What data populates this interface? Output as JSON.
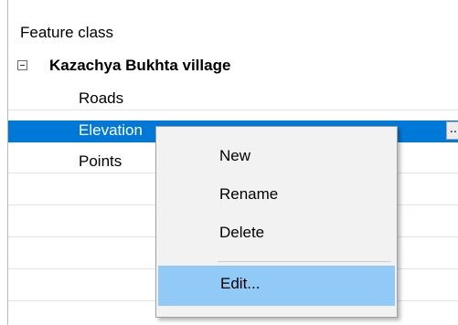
{
  "header": {
    "title": "Feature class"
  },
  "tree": {
    "group": {
      "label": "Kazachya Bukhta village",
      "expanded": true
    },
    "items": [
      {
        "label": "Roads"
      },
      {
        "label": "Elevation",
        "selected": true,
        "button_label": "..."
      },
      {
        "label": "Points"
      }
    ]
  },
  "context_menu": {
    "items": [
      {
        "label": "New"
      },
      {
        "label": "Rename"
      },
      {
        "label": "Delete"
      },
      {
        "label": "Edit...",
        "highlighted": true
      }
    ]
  },
  "colors": {
    "selection": "#0078d7",
    "menu_highlight": "#91c9f7",
    "menu_background": "#f2f2f2"
  }
}
